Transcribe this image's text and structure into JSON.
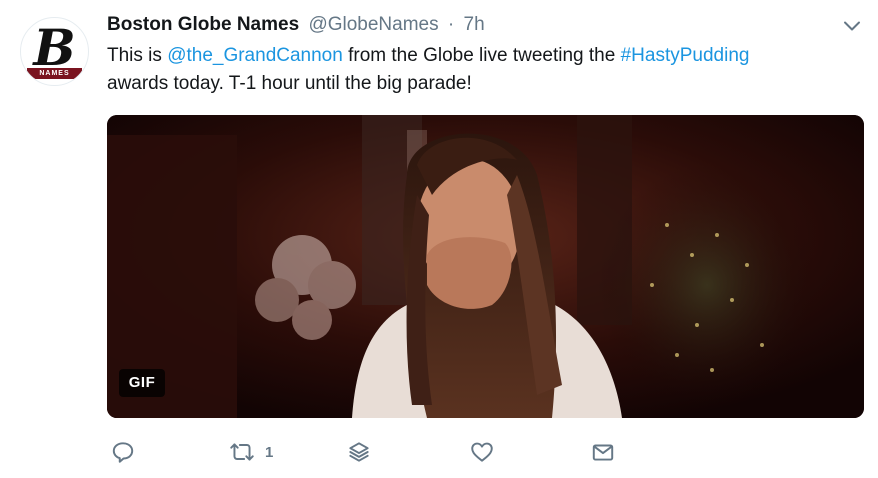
{
  "tweet": {
    "author": {
      "display_name": "Boston Globe Names",
      "handle": "@GlobeNames",
      "separator": "·",
      "time": "7h",
      "avatar_letter": "B",
      "avatar_ribbon": "NAMES"
    },
    "text_parts": {
      "t1": "This is ",
      "mention": "@the_GrandCannon",
      "t2": " from the Globe live tweeting the ",
      "hashtag": "#HastyPudding",
      "t3": " awards today. T-1 hour until the big parade!"
    },
    "media": {
      "badge": "GIF"
    },
    "actions": {
      "reply_icon": "reply-icon",
      "retweet_icon": "retweet-icon",
      "retweet_count": "1",
      "stack_icon": "layers-icon",
      "like_icon": "heart-icon",
      "dm_icon": "envelope-icon"
    }
  },
  "colors": {
    "link": "#1b95e0",
    "secondary": "#657786",
    "text": "#14171a",
    "ribbon": "#7a1420"
  }
}
